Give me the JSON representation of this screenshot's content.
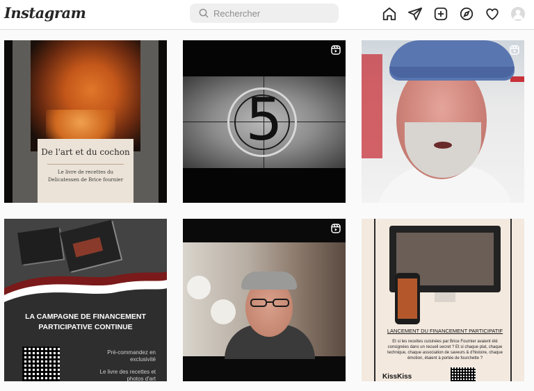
{
  "app": {
    "logo": "Instagram"
  },
  "search": {
    "placeholder": "Rechercher"
  },
  "nav": {
    "items": [
      "home-icon",
      "direct-icon",
      "new-post-icon",
      "explore-icon",
      "activity-icon",
      "profile-avatar"
    ]
  },
  "posts": [
    {
      "type": "image",
      "title": "De l'art et du cochon",
      "subtitle_line1": "Le livre de recettes du",
      "subtitle_line2": "Delicatessen de Brice fournier"
    },
    {
      "type": "reel",
      "countdown": "5"
    },
    {
      "type": "reel"
    },
    {
      "type": "image",
      "heading_line1": "LA CAMPAGNE DE FINANCEMENT",
      "heading_line2": "PARTICIPATIVE CONTINUE",
      "text_line1": "Pré-commandez en",
      "text_line2": "exclusivité",
      "text_line3": "Le livre des recettes et",
      "text_line4": "photos d'art"
    },
    {
      "type": "reel"
    },
    {
      "type": "image",
      "title": "LANCEMENT DU FINANCEMENT PARTICIPATIF",
      "body": "Et si les recettes cuisinées par Brice Fournier avaient été consignées dans un recueil secret ? Et si chaque plat, chaque technique, chaque association de saveurs & d'histoire, chaque émotion, étaient à portée de fourchette ?",
      "brand": "KissKiss"
    }
  ],
  "colors": {
    "border": "#dbdbdb",
    "background": "#fafafa",
    "text": "#262626"
  }
}
